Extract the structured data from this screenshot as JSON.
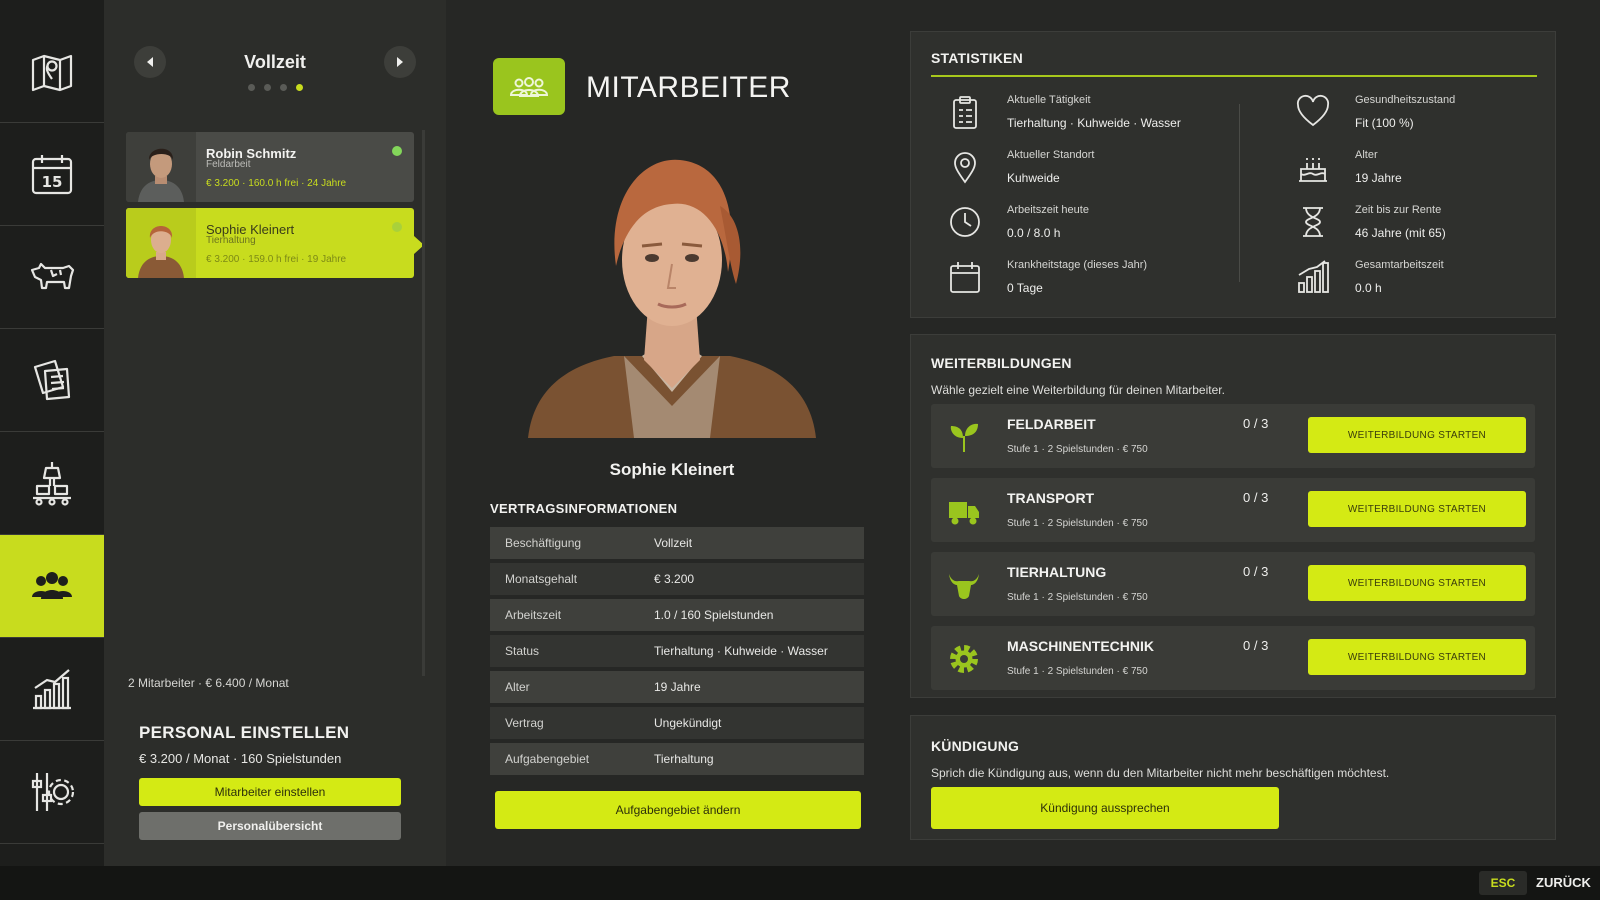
{
  "sidebar": {
    "items": [
      {
        "icon": "map-icon"
      },
      {
        "icon": "calendar-icon",
        "text": "15"
      },
      {
        "icon": "cow-icon"
      },
      {
        "icon": "documents-icon"
      },
      {
        "icon": "production-icon"
      },
      {
        "icon": "employees-icon",
        "active": true
      },
      {
        "icon": "statistics-icon"
      },
      {
        "icon": "settings-icon"
      }
    ]
  },
  "list": {
    "title": "Vollzeit",
    "page_dots": 4,
    "active_dot": 3,
    "employees": [
      {
        "name": "Robin Schmitz",
        "role": "Feldarbeit",
        "meta": "€ 3.200  ·  160.0 h frei  ·  24 Jahre"
      },
      {
        "name": "Sophie Kleinert",
        "role": "Tierhaltung",
        "meta": "€ 3.200  ·  159.0 h frei  ·  19 Jahre"
      }
    ],
    "summary": "2 Mitarbeiter  ·  € 6.400 / Monat"
  },
  "hire": {
    "title": "PERSONAL EINSTELLEN",
    "subtitle": "€ 3.200 / Monat  ·  160 Spielstunden",
    "primary_button": "Mitarbeiter einstellen",
    "secondary_button": "Personalübersicht"
  },
  "header": {
    "title": "MITARBEITER"
  },
  "employee": {
    "name": "Sophie Kleinert"
  },
  "contract": {
    "title": "VERTRAGSINFORMATIONEN",
    "rows": [
      {
        "key": "Beschäftigung",
        "value": "Vollzeit"
      },
      {
        "key": "Monatsgehalt",
        "value": "€ 3.200"
      },
      {
        "key": "Arbeitszeit",
        "value": "1.0 / 160 Spielstunden"
      },
      {
        "key": "Status",
        "value": "Tierhaltung · Kuhweide · Wasser"
      },
      {
        "key": "Alter",
        "value": "19 Jahre"
      },
      {
        "key": "Vertrag",
        "value": "Ungekündigt"
      },
      {
        "key": "Aufgabengebiet",
        "value": "Tierhaltung"
      }
    ],
    "button": "Aufgabengebiet ändern"
  },
  "stats": {
    "title": "STATISTIKEN",
    "items": [
      {
        "label": "Aktuelle Tätigkeit",
        "value": "Tierhaltung · Kuhweide · Wasser",
        "icon": "clipboard-icon"
      },
      {
        "label": "Aktueller Standort",
        "value": "Kuhweide",
        "icon": "location-pin-icon"
      },
      {
        "label": "Arbeitszeit heute",
        "value": "0.0 / 8.0 h",
        "icon": "clock-icon"
      },
      {
        "label": "Krankheitstage (dieses Jahr)",
        "value": "0 Tage",
        "icon": "calendar-icon"
      },
      {
        "label": "Gesundheitszustand",
        "value": "Fit (100 %)",
        "icon": "heart-icon"
      },
      {
        "label": "Alter",
        "value": "19 Jahre",
        "icon": "cake-icon"
      },
      {
        "label": "Zeit bis zur Rente",
        "value": "46 Jahre (mit 65)",
        "icon": "hourglass-icon"
      },
      {
        "label": "Gesamtarbeitszeit",
        "value": "0.0 h",
        "icon": "bar-chart-icon"
      }
    ]
  },
  "training": {
    "title": "WEITERBILDUNGEN",
    "description": "Wähle gezielt eine Weiterbildung für deinen Mitarbeiter.",
    "courses": [
      {
        "name": "FELDARBEIT",
        "info": "Stufe 1 · 2 Spielstunden · € 750",
        "progress": "0 / 3",
        "button": "WEITERBILDUNG STARTEN",
        "icon": "sprout-icon"
      },
      {
        "name": "TRANSPORT",
        "info": "Stufe 1 · 2 Spielstunden · € 750",
        "progress": "0 / 3",
        "button": "WEITERBILDUNG STARTEN",
        "icon": "truck-icon"
      },
      {
        "name": "TIERHALTUNG",
        "info": "Stufe 1 · 2 Spielstunden · € 750",
        "progress": "0 / 3",
        "button": "WEITERBILDUNG STARTEN",
        "icon": "bull-icon"
      },
      {
        "name": "MASCHINENTECHNIK",
        "info": "Stufe 1 · 2 Spielstunden · € 750",
        "progress": "0 / 3",
        "button": "WEITERBILDUNG STARTEN",
        "icon": "gear-icon"
      }
    ]
  },
  "termination": {
    "title": "KÜNDIGUNG",
    "description": "Sprich die Kündigung aus, wenn du den Mitarbeiter nicht mehr beschäftigen möchtest.",
    "button": "Kündigung aussprechen"
  },
  "footer": {
    "key": "ESC",
    "label": "ZURÜCK"
  },
  "colors": {
    "accent": "#d4ea14",
    "background": "#262725",
    "rail": "#1d1e1c"
  }
}
